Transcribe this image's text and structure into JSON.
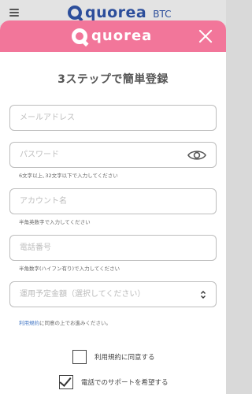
{
  "background_header": {
    "logo_text": "quorea",
    "logo_suffix": "BTC"
  },
  "modal": {
    "logo_text": "quorea",
    "title": "3ステップで簡単登録"
  },
  "form": {
    "email": {
      "placeholder": "メールアドレス"
    },
    "password": {
      "placeholder": "パスワード",
      "hint": "6文字以上､32文字以下で入力してください"
    },
    "account": {
      "placeholder": "アカウント名",
      "hint": "半角英数字で入力してください"
    },
    "phone": {
      "placeholder": "電話番号",
      "hint": "半角数字(ハイフン有り)で入力してください"
    },
    "investment": {
      "selected": "運用予定金額（選択してください）"
    }
  },
  "terms": {
    "link_text": "利用規約",
    "suffix_text": "に同意の上でお進みください。"
  },
  "checkboxes": [
    {
      "label": "利用規約に同意する",
      "checked": false
    },
    {
      "label": "電話でのサポートを希望する",
      "checked": true
    }
  ],
  "colors": {
    "brand_pink": "#f2769a",
    "brand_blue": "#2c4e9b",
    "link_blue": "#4a7cc7"
  }
}
